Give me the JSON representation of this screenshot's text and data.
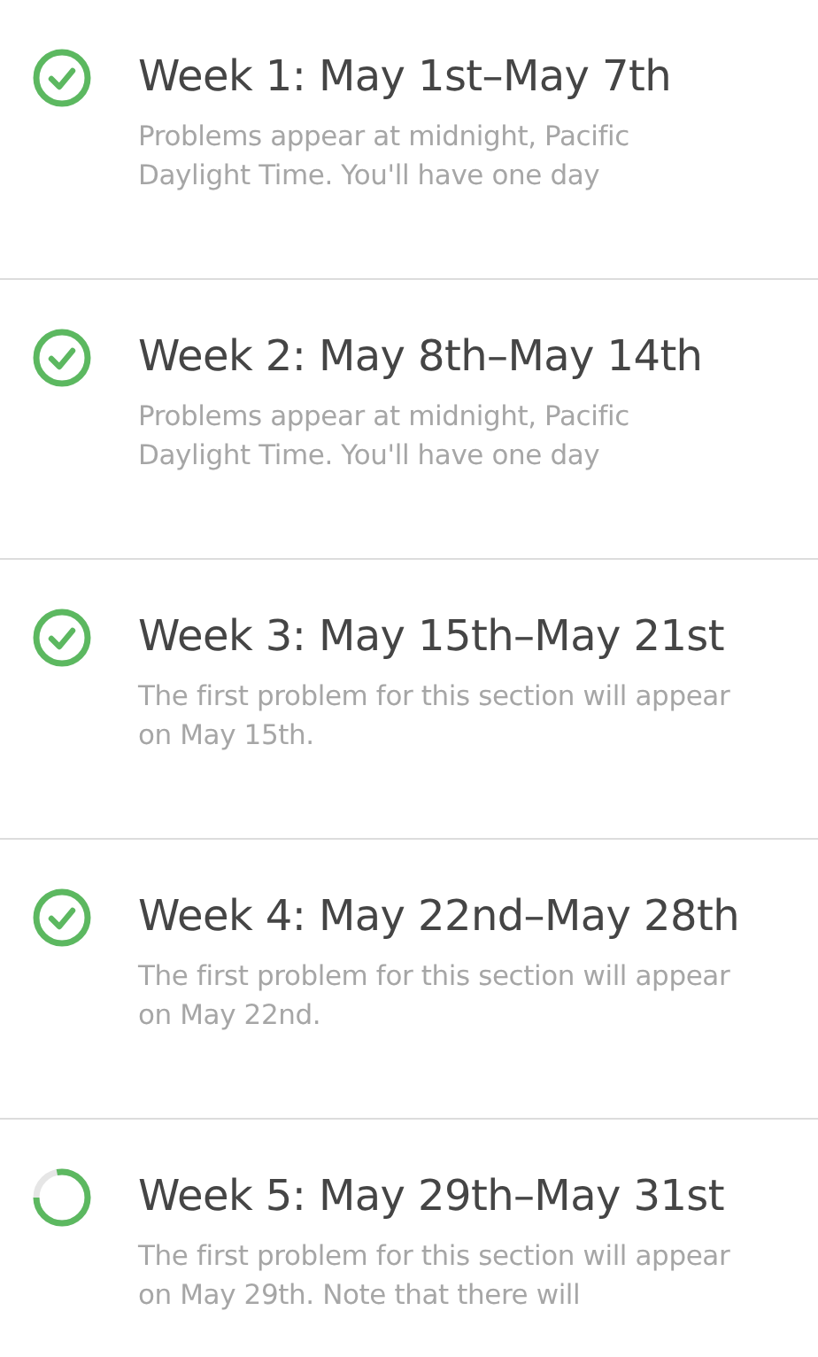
{
  "sections": [
    {
      "title": "Week 1: May 1st–May 7th",
      "status": {
        "kind": "complete"
      },
      "description": [
        "Problems appear at midnight, Pacific",
        "Daylight Time. You'll have one day"
      ]
    },
    {
      "title": "Week 2: May 8th–May 14th",
      "status": {
        "kind": "complete"
      },
      "description": [
        "Problems appear at midnight, Pacific",
        "Daylight Time. You'll have one day"
      ]
    },
    {
      "title": "Week 3: May 15th–May 21st",
      "status": {
        "kind": "complete"
      },
      "description": [
        "The first problem for this section will appear",
        "on May 15th."
      ]
    },
    {
      "title": "Week 4: May 22nd–May 28th",
      "status": {
        "kind": "complete"
      },
      "description": [
        "The first problem for this section will appear",
        "on May 22nd."
      ]
    },
    {
      "title": "Week 5: May 29th–May 31st",
      "status": {
        "kind": "progress"
      },
      "description": [
        "The first problem for this section will appear",
        "on May 29th. Note that there will"
      ]
    }
  ]
}
